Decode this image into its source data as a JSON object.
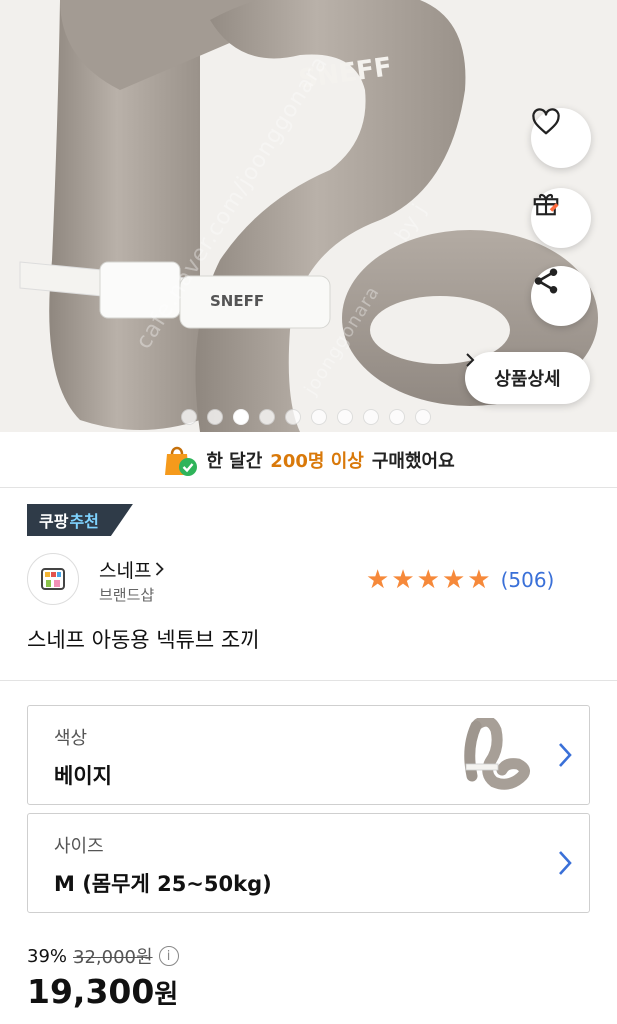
{
  "hero": {
    "watermark_1": "cafe.naver.com/joonggonara",
    "watermark_2": "by j",
    "watermark_3": "joonggonara",
    "detail_button_label": "상품상세",
    "slide_count": 10,
    "active_slide": 2
  },
  "banner": {
    "prefix": "한 달간",
    "highlight": "200명 이상",
    "suffix": "구매했어요"
  },
  "badge": {
    "part1": "쿠팡",
    "part2": "추천"
  },
  "brand": {
    "name": "스네프",
    "sub": "브랜드샵"
  },
  "rating": {
    "stars": 5,
    "review_count": "(506)"
  },
  "product": {
    "title": "스네프 아동용 넥튜브 조끼"
  },
  "options": {
    "color_label": "색상",
    "color_value": "베이지",
    "size_label": "사이즈",
    "size_value": "M (몸무게 25~50kg)"
  },
  "price": {
    "discount": "39%",
    "original": "32,000원",
    "current": "19,300",
    "unit": "원"
  },
  "colors": {
    "accent_orange": "#d9790a",
    "star": "#f6893a",
    "link_blue": "#3a70d8",
    "badge_bg": "#2f3b48"
  }
}
